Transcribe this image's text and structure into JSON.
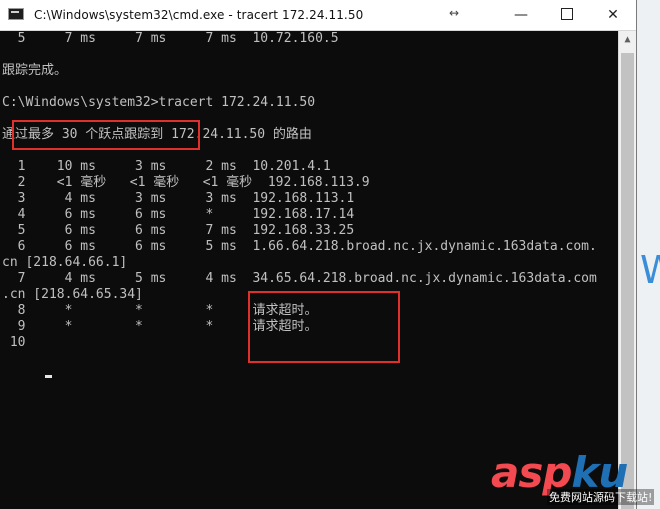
{
  "window": {
    "title": "C:\\Windows\\system32\\cmd.exe - tracert  172.24.11.50",
    "controls": {
      "minimize": "—",
      "maximize": "",
      "close": "✕"
    }
  },
  "console_lines": [
    "  5     7 ms     7 ms     7 ms  10.72.160.5",
    "",
    "跟踪完成。",
    "",
    "C:\\Windows\\system32>tracert 172.24.11.50",
    "",
    "通过最多 30 个跃点跟踪到 172.24.11.50 的路由",
    "",
    "  1    10 ms     3 ms     2 ms  10.201.4.1",
    "  2    <1 毫秒   <1 毫秒   <1 毫秒  192.168.113.9",
    "  3     4 ms     3 ms     3 ms  192.168.113.1",
    "  4     6 ms     6 ms     *     192.168.17.14",
    "  5     6 ms     6 ms     7 ms  192.168.33.25",
    "  6     6 ms     6 ms     5 ms  1.66.64.218.broad.nc.jx.dynamic.163data.com.",
    "cn [218.64.66.1]",
    "  7     4 ms     5 ms     4 ms  34.65.64.218.broad.nc.jx.dynamic.163data.com",
    ".cn [218.64.65.34]",
    "  8     *        *        *     请求超时。",
    "  9     *        *        *     请求超时。",
    " 10"
  ],
  "background": {
    "letter": "W"
  },
  "watermark": {
    "asp": "asp",
    "ku": "ku",
    "sub": "免费网站源码下载站!"
  }
}
